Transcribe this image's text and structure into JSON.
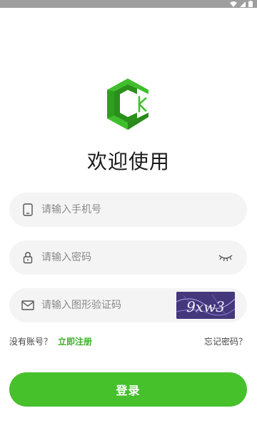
{
  "app": {
    "title": "欢迎使用"
  },
  "form": {
    "phone": {
      "placeholder": "请输入手机号",
      "value": "",
      "icon": "phone-icon"
    },
    "password": {
      "placeholder": "请输入密码",
      "value": "",
      "icon": "lock-icon",
      "toggle_icon": "eye-closed-icon"
    },
    "captcha": {
      "placeholder": "请输入图形验证码",
      "value": "",
      "icon": "mail-icon",
      "image_text": "9xw3"
    }
  },
  "links": {
    "no_account": "没有账号？",
    "register": "立即注册",
    "forgot": "忘记密码？"
  },
  "actions": {
    "login": "登录"
  },
  "colors": {
    "brand_green": "#46c02b",
    "link_green": "#3fae2a",
    "field_bg": "#f4f4f4"
  }
}
